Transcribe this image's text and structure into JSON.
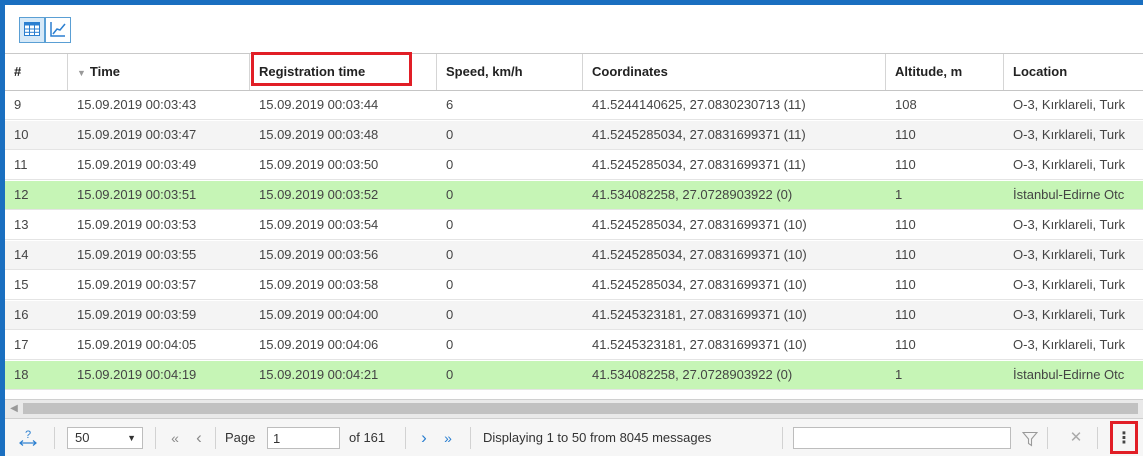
{
  "toolbar": {
    "table_view_icon": "table-grid-icon",
    "chart_view_icon": "line-chart-icon"
  },
  "columns": [
    {
      "key": "num",
      "label": "#"
    },
    {
      "key": "time",
      "label": "Time",
      "sort": "desc"
    },
    {
      "key": "reg_time",
      "label": "Registration time"
    },
    {
      "key": "speed",
      "label": "Speed, km/h"
    },
    {
      "key": "coords",
      "label": "Coordinates"
    },
    {
      "key": "alt",
      "label": "Altitude, m"
    },
    {
      "key": "location",
      "label": "Location"
    }
  ],
  "rows": [
    {
      "num": "9",
      "time": "15.09.2019 00:03:43",
      "reg_time": "15.09.2019 00:03:44",
      "speed": "6",
      "coords": "41.5244140625, 27.0830230713 (11)",
      "alt": "108",
      "location": "O-3, Kırklareli, Turk",
      "highlight": false
    },
    {
      "num": "10",
      "time": "15.09.2019 00:03:47",
      "reg_time": "15.09.2019 00:03:48",
      "speed": "0",
      "coords": "41.5245285034, 27.0831699371 (11)",
      "alt": "110",
      "location": "O-3, Kırklareli, Turk",
      "highlight": false
    },
    {
      "num": "11",
      "time": "15.09.2019 00:03:49",
      "reg_time": "15.09.2019 00:03:50",
      "speed": "0",
      "coords": "41.5245285034, 27.0831699371 (11)",
      "alt": "110",
      "location": "O-3, Kırklareli, Turk",
      "highlight": false
    },
    {
      "num": "12",
      "time": "15.09.2019 00:03:51",
      "reg_time": "15.09.2019 00:03:52",
      "speed": "0",
      "coords": "41.534082258, 27.0728903922 (0)",
      "alt": "1",
      "location": "İstanbul-Edirne Otc",
      "highlight": true
    },
    {
      "num": "13",
      "time": "15.09.2019 00:03:53",
      "reg_time": "15.09.2019 00:03:54",
      "speed": "0",
      "coords": "41.5245285034, 27.0831699371 (10)",
      "alt": "110",
      "location": "O-3, Kırklareli, Turk",
      "highlight": false
    },
    {
      "num": "14",
      "time": "15.09.2019 00:03:55",
      "reg_time": "15.09.2019 00:03:56",
      "speed": "0",
      "coords": "41.5245285034, 27.0831699371 (10)",
      "alt": "110",
      "location": "O-3, Kırklareli, Turk",
      "highlight": false
    },
    {
      "num": "15",
      "time": "15.09.2019 00:03:57",
      "reg_time": "15.09.2019 00:03:58",
      "speed": "0",
      "coords": "41.5245285034, 27.0831699371 (10)",
      "alt": "110",
      "location": "O-3, Kırklareli, Turk",
      "highlight": false
    },
    {
      "num": "16",
      "time": "15.09.2019 00:03:59",
      "reg_time": "15.09.2019 00:04:00",
      "speed": "0",
      "coords": "41.5245323181, 27.0831699371 (10)",
      "alt": "110",
      "location": "O-3, Kırklareli, Turk",
      "highlight": false
    },
    {
      "num": "17",
      "time": "15.09.2019 00:04:05",
      "reg_time": "15.09.2019 00:04:06",
      "speed": "0",
      "coords": "41.5245323181, 27.0831699371 (10)",
      "alt": "110",
      "location": "O-3, Kırklareli, Turk",
      "highlight": false
    },
    {
      "num": "18",
      "time": "15.09.2019 00:04:19",
      "reg_time": "15.09.2019 00:04:21",
      "speed": "0",
      "coords": "41.534082258, 27.0728903922 (0)",
      "alt": "1",
      "location": "İstanbul-Edirne Otc",
      "highlight": true
    }
  ],
  "pager": {
    "help_label": "?",
    "page_size": "50",
    "first_icon": "«",
    "prev_icon": "‹",
    "page_label": "Page",
    "page_value": "1",
    "of_label": "of 161",
    "next_icon": "›",
    "last_icon": "»",
    "display_info": "Displaying 1 to 50 from 8045 messages",
    "filter_value": "",
    "menu_icon": "⋮"
  },
  "colors": {
    "frame": "#1a6fc0",
    "row_highlight": "#c6f5b6",
    "annotation_red": "#e11e26"
  }
}
